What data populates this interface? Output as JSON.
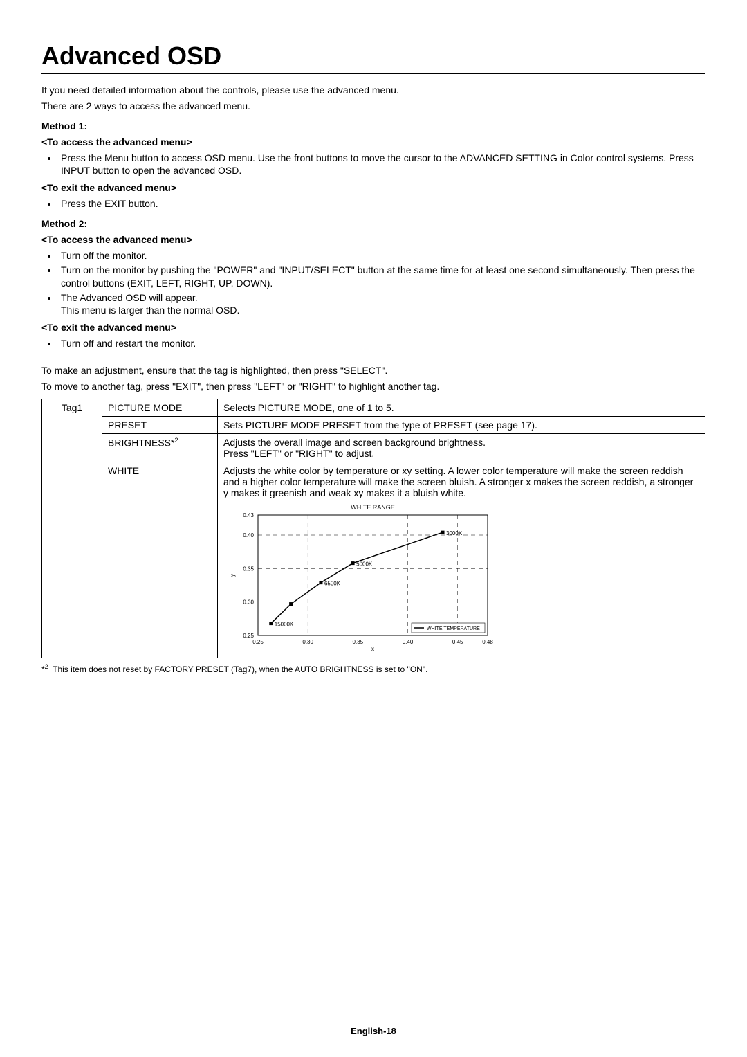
{
  "title": "Advanced OSD",
  "intro": {
    "line1": "If you need detailed information about the controls, please use the advanced menu.",
    "line2": "There are 2 ways to access the advanced menu."
  },
  "method1": {
    "heading": "Method 1:",
    "access_title": "<To access the advanced menu>",
    "access_items": [
      "Press the Menu button to access OSD menu. Use the front buttons to move the cursor to the ADVANCED SETTING in Color control systems. Press INPUT button to open the advanced OSD."
    ],
    "exit_title": "<To exit the advanced menu>",
    "exit_items": [
      "Press the EXIT button."
    ]
  },
  "method2": {
    "heading": "Method 2:",
    "access_title": "<To access the advanced menu>",
    "access_items": [
      "Turn off the monitor.",
      "Turn on the monitor by pushing the \"POWER\" and \"INPUT/SELECT\" button at the same time for at least one second simultaneously. Then press the control buttons (EXIT, LEFT, RIGHT, UP, DOWN).",
      "The Advanced OSD will appear.\nThis menu is larger than the normal OSD."
    ],
    "exit_title": "<To exit the advanced menu>",
    "exit_items": [
      "Turn off and restart the monitor."
    ]
  },
  "instructions": {
    "line1": "To make an adjustment, ensure that the tag is highlighted, then press \"SELECT\".",
    "line2": "To move to another tag, press \"EXIT\", then press \"LEFT\" or \"RIGHT\" to highlight another tag."
  },
  "table": {
    "tag": "Tag1",
    "rows": [
      {
        "name": "PICTURE MODE",
        "name_sup": "",
        "desc": "Selects PICTURE MODE, one of 1 to 5."
      },
      {
        "name": "PRESET",
        "name_sup": "",
        "desc": "Sets PICTURE MODE PRESET from the type of PRESET (see page 17)."
      },
      {
        "name": "BRIGHTNESS*",
        "name_sup": "2",
        "desc": "Adjusts the overall image and screen background brightness.\nPress \"LEFT\" or \"RIGHT\" to adjust."
      },
      {
        "name": "WHITE",
        "name_sup": "",
        "desc": "Adjusts the white color by temperature or xy setting. A lower color temperature will make the screen reddish and a higher color temperature will make the screen bluish. A stronger x makes the screen reddish, a stronger y makes it greenish and weak xy makes it a bluish white."
      }
    ]
  },
  "chart_data": {
    "type": "line",
    "title": "WHITE RANGE",
    "xlabel": "x",
    "ylabel": "y",
    "xlim": [
      0.25,
      0.48
    ],
    "ylim": [
      0.25,
      0.43
    ],
    "x_ticks": [
      0.25,
      0.3,
      0.35,
      0.4,
      0.45,
      0.48
    ],
    "y_ticks": [
      0.25,
      0.3,
      0.35,
      0.4,
      0.43
    ],
    "legend": "WHITE TEMPERATURE",
    "series": [
      {
        "name": "WHITE TEMPERATURE",
        "x": [
          0.263,
          0.283,
          0.313,
          0.345,
          0.435
        ],
        "y": [
          0.268,
          0.297,
          0.329,
          0.358,
          0.404
        ],
        "labels": [
          "15000K",
          "",
          "6500K",
          "5000K",
          "3000K"
        ]
      }
    ]
  },
  "footnote": {
    "mark": "*",
    "sup": "2",
    "text": "This item does not reset by FACTORY PRESET (Tag7), when the AUTO BRIGHTNESS is set to \"ON\"."
  },
  "footer": "English-18"
}
